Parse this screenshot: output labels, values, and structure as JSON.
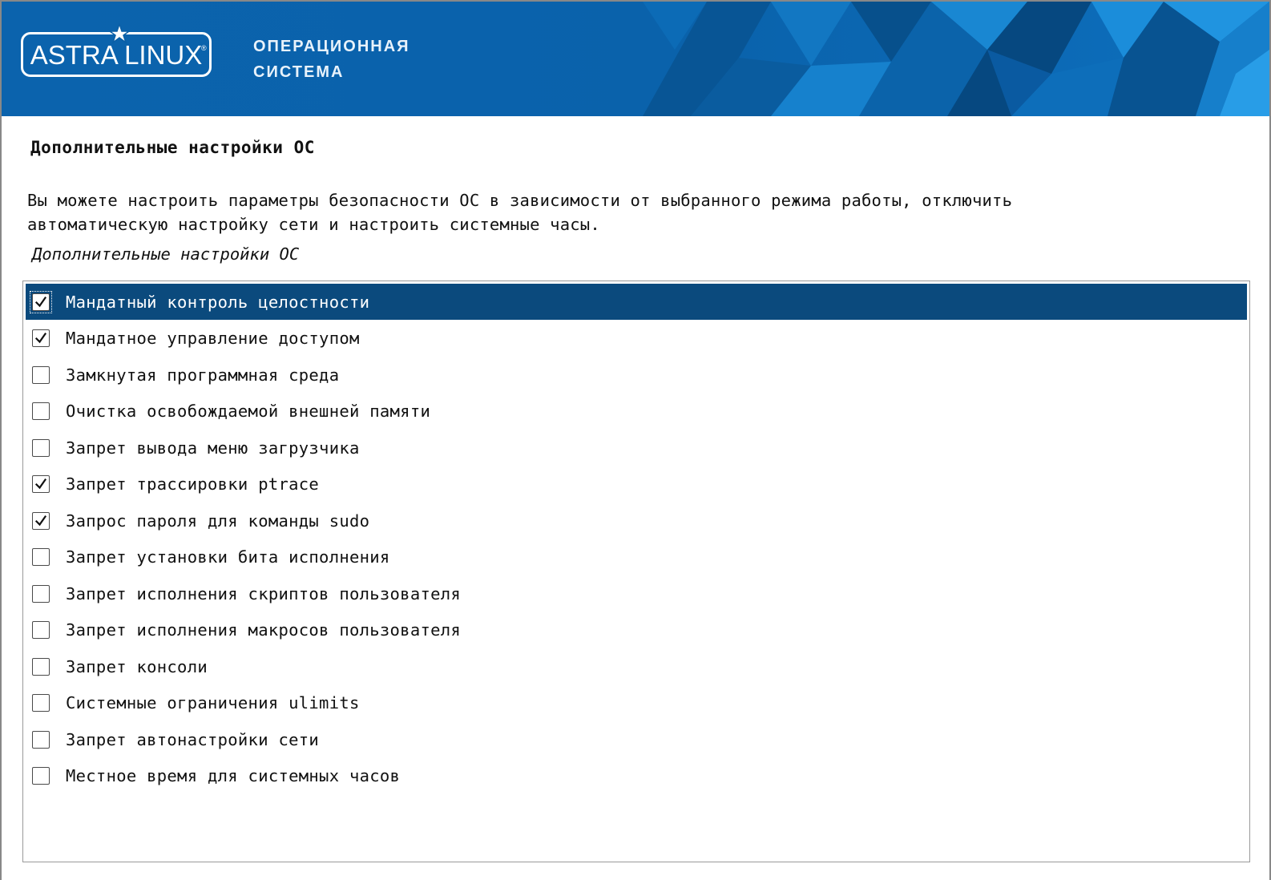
{
  "header": {
    "logo_text": "ASTRA LINUX",
    "subtitle_line1": "ОПЕРАЦИОННАЯ",
    "subtitle_line2": "СИСТЕМА",
    "brand_color": "#0a5fa6"
  },
  "page": {
    "title": "Дополнительные настройки ОС",
    "description_line1": "Вы можете настроить параметры безопасности ОС в зависимости от выбранного режима работы, отключить",
    "description_line2": "автоматическую настройку сети и настроить системные часы.",
    "list_caption": "Дополнительные настройки ОС"
  },
  "options": [
    {
      "label": "Мандатный контроль целостности",
      "checked": true,
      "selected": true
    },
    {
      "label": "Мандатное управление доступом",
      "checked": true,
      "selected": false
    },
    {
      "label": "Замкнутая программная среда",
      "checked": false,
      "selected": false
    },
    {
      "label": "Очистка освобождаемой внешней памяти",
      "checked": false,
      "selected": false
    },
    {
      "label": "Запрет вывода меню загрузчика",
      "checked": false,
      "selected": false
    },
    {
      "label": "Запрет трассировки ptrace",
      "checked": true,
      "selected": false
    },
    {
      "label": "Запрос пароля для команды sudo",
      "checked": true,
      "selected": false
    },
    {
      "label": "Запрет установки бита исполнения",
      "checked": false,
      "selected": false
    },
    {
      "label": "Запрет исполнения скриптов пользователя",
      "checked": false,
      "selected": false
    },
    {
      "label": "Запрет исполнения макросов пользователя",
      "checked": false,
      "selected": false
    },
    {
      "label": "Запрет консоли",
      "checked": false,
      "selected": false
    },
    {
      "label": "Системные ограничения ulimits",
      "checked": false,
      "selected": false
    },
    {
      "label": "Запрет автонастройки сети",
      "checked": false,
      "selected": false
    },
    {
      "label": "Местное время для системных часов",
      "checked": false,
      "selected": false
    }
  ],
  "colors": {
    "selection": "#0b4a7d"
  }
}
